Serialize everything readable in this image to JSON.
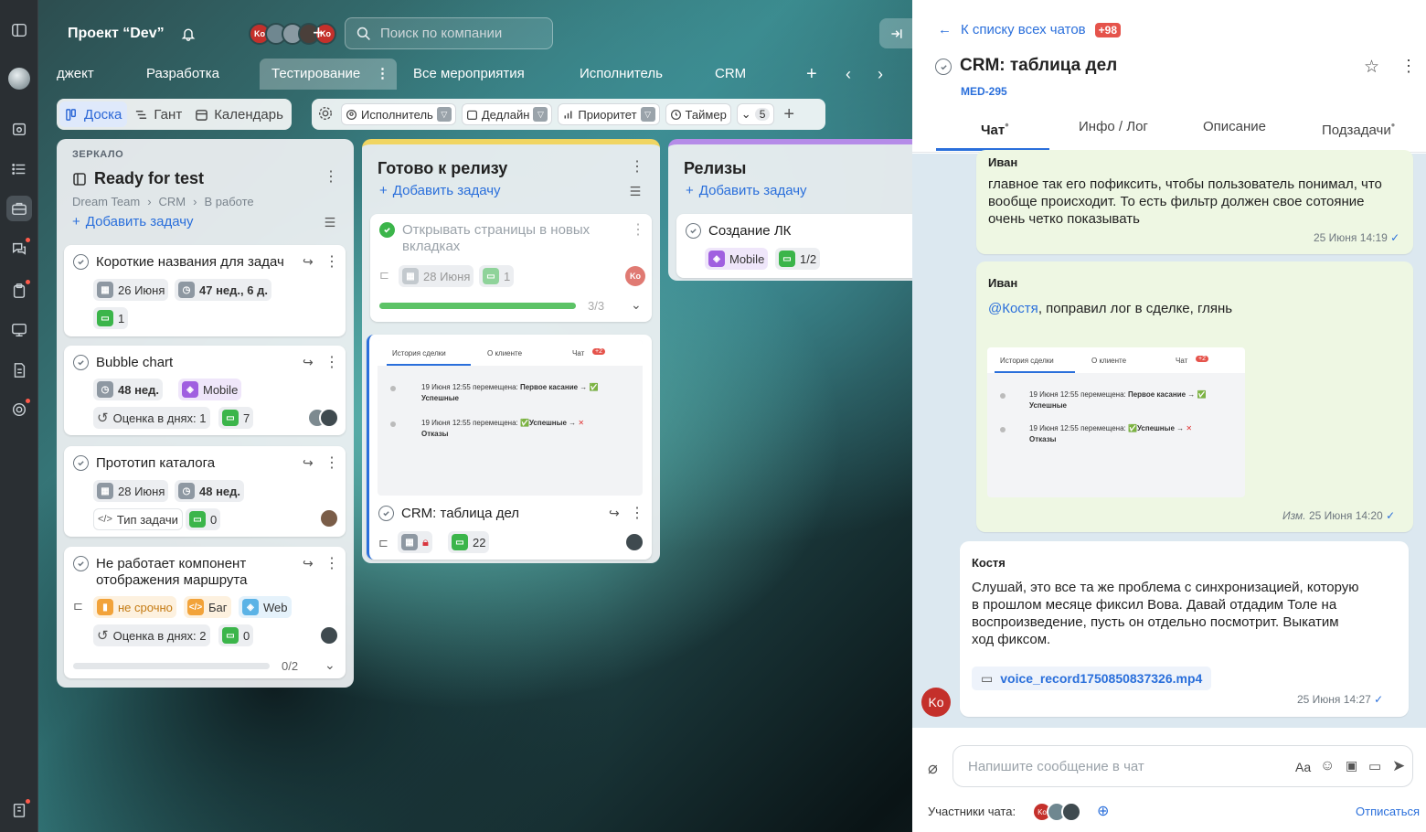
{
  "project": {
    "title": "Проект “Dev”",
    "search_placeholder": "Поиск по компании"
  },
  "avatars": [
    {
      "initials": "Ko",
      "color": "#c4302b"
    },
    {
      "initials": "",
      "color": "#6f8790"
    },
    {
      "initials": "",
      "color": "#8a9aa2"
    },
    {
      "initials": "",
      "color": "#4a3f3a"
    },
    {
      "initials": "Ko",
      "color": "#c4302b"
    }
  ],
  "tabs": [
    "джект",
    "Разработка",
    "Тестирование",
    "Все мероприятия",
    "Исполнитель",
    "CRM"
  ],
  "views": {
    "board": "Доска",
    "gantt": "Гант",
    "calendar": "Календарь"
  },
  "filters": {
    "assignee": "Исполнитель",
    "deadline": "Дедлайн",
    "priority": "Приоритет",
    "timer": "Таймер",
    "more_count": "5"
  },
  "columns": {
    "ready": {
      "label": "ЗЕРКАЛО",
      "title": "Ready for test",
      "breadcrumb": [
        "Dream Team",
        "CRM",
        "В работе"
      ],
      "add": "Добавить задачу",
      "cards": [
        {
          "title": "Короткие названия для задач",
          "date": "26 Июня",
          "duration": "47 нед., 6 д.",
          "comments": "1"
        },
        {
          "title": "Bubble chart",
          "duration": "48 нед.",
          "tag": "Mobile",
          "estimate": "Оценка в днях: 1",
          "comments": "7"
        },
        {
          "title": "Прототип каталога",
          "date": "28 Июня",
          "duration": "48 нед.",
          "type": "Тип задачи",
          "comments": "0"
        },
        {
          "title_line1": "Не работает компонент",
          "title_line2": "отображения маршрута",
          "priority": "не срочно",
          "tag_bug": "Баг",
          "tag_web": "Web",
          "estimate": "Оценка в днях: 2",
          "comments": "0",
          "progress": "0/2",
          "progress_value": 0
        }
      ]
    },
    "release_ready": {
      "title": "Готово к релизу",
      "add": "Добавить задачу",
      "cards": [
        {
          "title_line1": "Открывать страницы в новых",
          "title_line2": "вкладках",
          "date": "28 Июня",
          "comments": "1",
          "assignee": "Ko",
          "progress": "3/3",
          "progress_value": 1
        },
        {
          "title": "CRM: таблица дел",
          "comments": "22",
          "preview": {
            "tab1": "История сделки",
            "tab2": "О клиенте",
            "tab3": "Чат",
            "badge": "+2",
            "line1_a": "19 Июня 12:55 перемещена: ",
            "line1_b": "Первое касание → ",
            "line1_c": "Успешные",
            "line2_a": "19 Июня 12:55 перемещена: ",
            "line2_b": "Успешные → ",
            "line2_c": "Отказы"
          }
        }
      ]
    },
    "releases": {
      "title": "Релизы",
      "add": "Добавить задачу",
      "cards": [
        {
          "title": "Создание ЛК",
          "tag": "Mobile",
          "subtasks": "1/2"
        }
      ]
    }
  },
  "panel": {
    "back": "К списку всех чатов",
    "badge": "+98",
    "title": "CRM: таблица дел",
    "code": "MED-295",
    "tabs": [
      "Чат",
      "Инфо / Лог",
      "Описание",
      "Подзадачи"
    ],
    "messages": [
      {
        "author": "Иван",
        "lines": [
          "главное так его пофиксить, чтобы пользователь понимал, что",
          "вообще происходит. То есть фильтр должен свое сотояние",
          "очень четко показывать"
        ],
        "time": "25 Июня 14:19"
      },
      {
        "author": "Иван",
        "mention": "@Костя",
        "text": ", поправил лог в сделке, глянь",
        "edited": "Изм.",
        "time": "25 Июня 14:20"
      },
      {
        "author": "Костя",
        "lines": [
          "Слушай, это все та же проблема с синхронизацией, которую",
          "в прошлом месяце фиксил Вова. Давай отдадим Толе на",
          "воспроизведение, пусть он отдельно посмотрит. Выкатим",
          "ход фиксом."
        ],
        "file": "voice_record1750850837326.mp4",
        "time": "25 Июня 14:27",
        "avatar": "Ko"
      }
    ],
    "composer_placeholder": "Напишите сообщение в чат",
    "format_label": "Aa",
    "participants_label": "Участники чата:",
    "participants_avatar": "Ko",
    "unsubscribe": "Отписаться"
  },
  "colors": {
    "accent": "#2a6fdb",
    "success": "#3bb54a",
    "danger": "#d9363e"
  }
}
